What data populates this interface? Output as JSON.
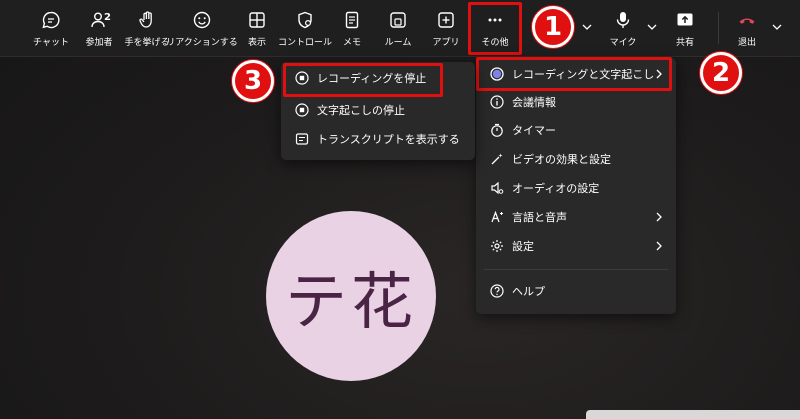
{
  "toolbar": {
    "chat": "チャット",
    "people": "参加者",
    "people_count": "2",
    "raise_hand": "手を挙げる",
    "reactions": "リアクションする",
    "view": "表示",
    "controls": "コントロール",
    "notes": "メモ",
    "rooms": "ルーム",
    "apps": "アプリ",
    "more": "その他",
    "mic": "マイク",
    "share": "共有",
    "leave": "退出"
  },
  "more_menu": {
    "recording": "レコーディングと文字起こし",
    "meeting_info": "会議情報",
    "timer": "タイマー",
    "video_effects": "ビデオの効果と設定",
    "audio_settings": "オーディオの設定",
    "language": "言語と音声",
    "settings": "設定",
    "help": "ヘルプ"
  },
  "recording_submenu": {
    "stop_recording": "レコーディングを停止",
    "stop_transcription": "文字起こしの停止",
    "show_transcript": "トランスクリプトを表示する"
  },
  "avatar": {
    "initials": "テ花",
    "color": "#ead2e5"
  },
  "callouts": {
    "one": "1",
    "two": "2",
    "three": "3"
  },
  "colors": {
    "highlight": "#e01010",
    "leave": "#e0455a",
    "recording_dot": "#7b83eb"
  }
}
